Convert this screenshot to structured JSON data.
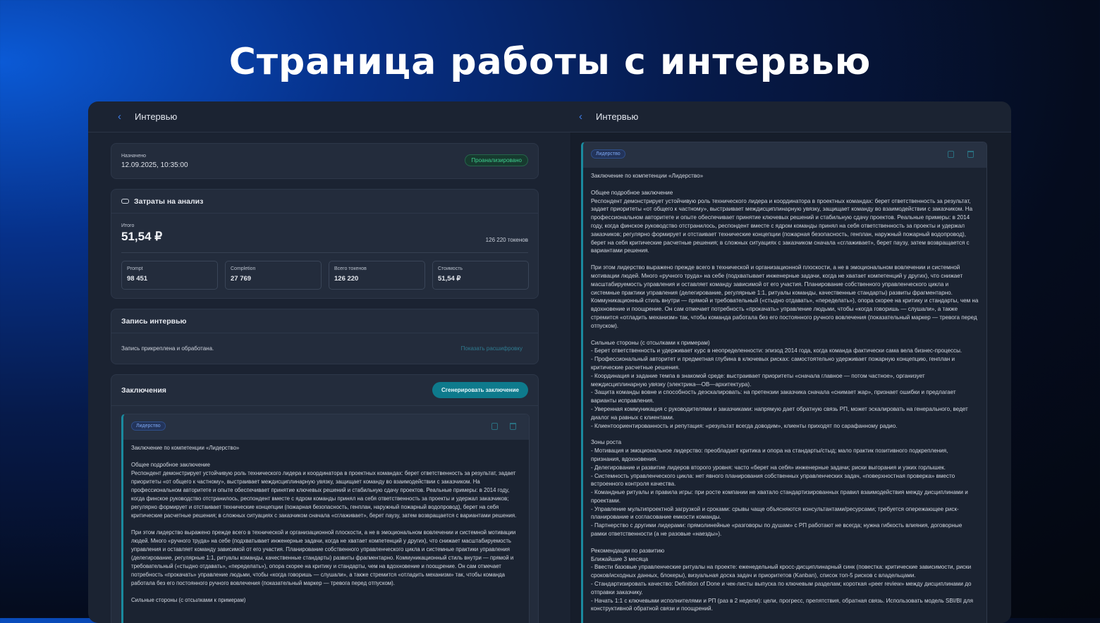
{
  "hero": {
    "title": "Страница работы с интервью"
  },
  "header": {
    "left_title": "Интервью",
    "right_title": "Интервью"
  },
  "status_card": {
    "assigned_label": "Назначено",
    "assigned_value": "12.09.2025, 10:35:00",
    "status_badge": "Проанализировано"
  },
  "costs": {
    "title": "Затраты на анализ",
    "total_label": "Итого",
    "total_value": "51,54 ₽",
    "tokens_total": "126 220 токенов",
    "metrics": [
      {
        "label": "Prompt",
        "value": "98 451"
      },
      {
        "label": "Completion",
        "value": "27 769"
      },
      {
        "label": "Всего токенов",
        "value": "126 220"
      },
      {
        "label": "Стоимость",
        "value": "51,54 ₽"
      }
    ]
  },
  "recording": {
    "title": "Запись интервью",
    "status_text": "Запись прикреплена и обработана.",
    "show_transcript": "Показать расшифровку"
  },
  "conclusions": {
    "title": "Заключения",
    "generate_button": "Сгенерировать заключение",
    "tag": "Лидерство",
    "heading": "Заключение по компетенции «Лидерство»",
    "p1": "Общее подробное заключение\nРеспондент демонстрирует устойчивую роль технического лидера и координатора в проектных командах: берет ответственность за результат, задает приоритеты «от общего к частному», выстраивает междисциплинарную увязку, защищает команду во взаимодействии с заказчиком. На профессиональном авторитете и опыте обеспечивает принятие ключевых решений и стабильную сдачу проектов. Реальные примеры: в 2014 году, когда финское руководство отстранилось, респондент вместе с ядром команды принял на себя ответственность за проекты и удержал заказчиков; регулярно формирует и отстаивает технические концепции (пожарная безопасность, генплан, наружный пожарный водопровод), берет на себя критические расчетные решения; в сложных ситуациях с заказчиком сначала «сглаживает», берет паузу, затем возвращается с вариантами решения.",
    "p2": "При этом лидерство выражено прежде всего в технической и организационной плоскости, а не в эмоциональном вовлечении и системной мотивации людей. Много «ручного труда» на себе (подхватывает инженерные задачи, когда не хватает компетенций у других), что снижает масштабируемость управления и оставляет команду зависимой от его участия. Планирование собственного управленческого цикла и системные практики управления (делегирование, регулярные 1:1, ритуалы команды, качественные стандарты) развиты фрагментарно. Коммуникационный стиль внутри — прямой и требовательный («стыдно отдавать», «переделать»), опора скорее на критику и стандарты, чем на вдохновение и поощрение. Он сам отмечает потребность «прокачать» управление людьми, чтобы «когда говоришь — слушали», а также стремится «отладить механизм» так, чтобы команда работала без его постоянного ручного вовлечения (показательный маркер — тревога перед отпуском).",
    "p3": "Сильные стороны (с отсылками к примерам)\n- Берет ответственность и удерживает курс в неопределенности: эпизод 2014 года, когда команда фактически сама вела бизнес-процессы.\n- Профессиональный авторитет и предметная глубина в ключевых рисках: самостоятельно удерживает пожарную концепцию, генплан и критические расчетные решения.\n- Координация и задание темпа в знакомой среде: выстраивает приоритеты «сначала главное — потом частное», организует междисциплинарную увязку (электрика—ОВ—архитектура).\n- Защита команды вовне и способность деэскалировать: на претензии заказчика сначала «снимает жар», признает ошибки и предлагает варианты исправления.\n- Уверенная коммуникация с руководителями и заказчиками: напрямую дает обратную связь РП, может эскалировать на генерального, ведет диалог на равных с клиентами.\n- Клиентоориентированность и репутация: «результат всегда доводим», клиенты приходят по сарафанному радио.",
    "p4": "Зоны роста\n- Мотивация и эмоциональное лидерство: преобладает критика и опора на стандарты/стыд; мало практик позитивного подкрепления, признания, вдохновения.\n- Делегирование и развитие лидеров второго уровня: часто «берет на себя» инженерные задачи; риски выгорания и узких горлышек.\n- Системность управленческого цикла: нет явного планирования собственных управленческих задач, «поверхностная проверка» вместо встроенного контроля качества.\n- Командные ритуалы и правила игры: при росте компании не хватало стандартизированных правил взаимодействия между дисциплинами и проектами.\n- Управление мультипроектной загрузкой и сроками: срывы чаще объясняются консультантами/ресурсами; требуется опережающее риск-планирование и согласование емкости команды.\n- Партнерство с другими лидерами: прямолинейные «разговоры по душам» с РП работают не всегда; нужна гибкость влияния, договорные рамки ответственности (а не разовые «наезды»).",
    "p5": "Рекомендации по развитию\nБлижайшие 3 месяца\n- Ввести базовые управленческие ритуалы на проекте: еженедельный кросс-дисциплинарный синк (повестка: критические зависимости, риски сроков/исходных данных, блокеры), визуальная доска задач и приоритетов (Kanban), список топ-5 рисков с владельцами.\n- Стандартизировать качество: Definition of Done и чек-листы выпуска по ключевым разделам; короткая «peer review» между дисциплинами до отправки заказчику.\n- Начать 1:1 с ключевыми исполнителями и РП (раз в 2 недели): цели, прогресс, препятствия, обратная связь. Использовать модель SBI/BI для конструктивной обратной связи и поощрений.",
    "left_trailing": "Сильные стороны (с отсылками к примерам)"
  }
}
